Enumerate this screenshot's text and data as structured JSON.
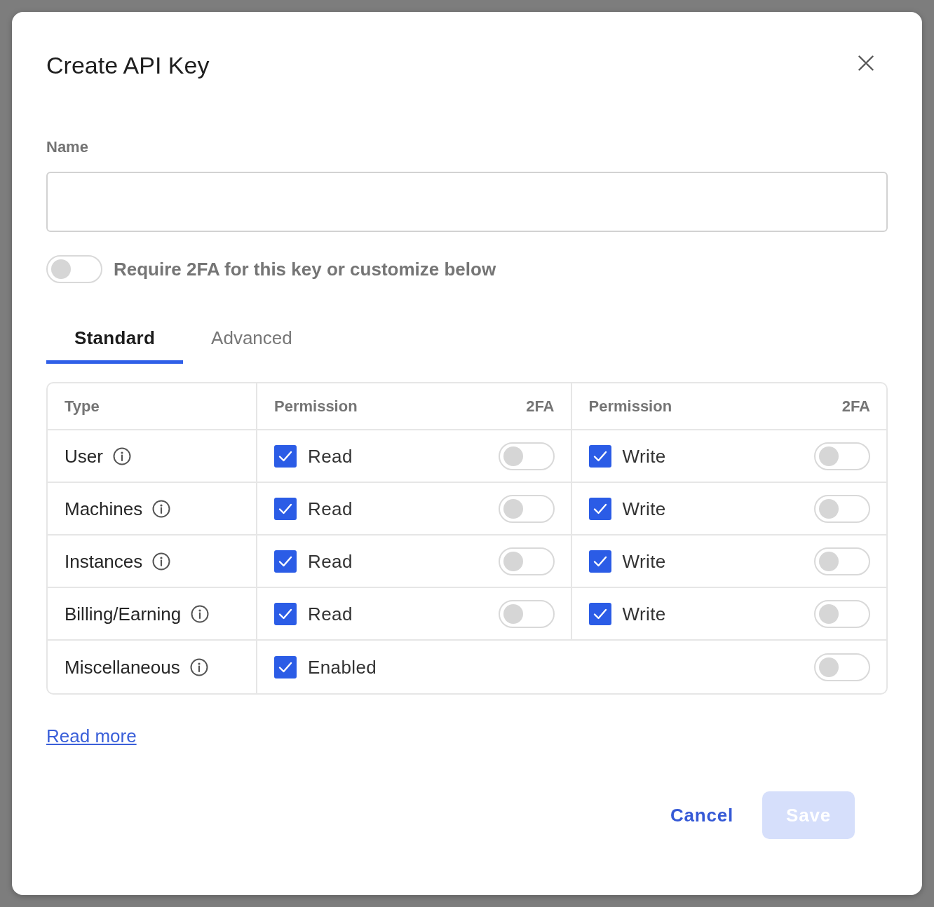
{
  "dialog": {
    "title": "Create API Key"
  },
  "name_field": {
    "label": "Name"
  },
  "require_2fa": {
    "label": "Require 2FA for this key or customize below",
    "on": false
  },
  "tabs": [
    {
      "label": "Standard",
      "selected": true
    },
    {
      "label": "Advanced",
      "selected": false
    }
  ],
  "table": {
    "columns": [
      "Type",
      "Permission",
      "2FA",
      "Permission",
      "2FA"
    ],
    "rows": [
      {
        "type": "User",
        "permissions": [
          {
            "label": "Read",
            "checked": true,
            "two_fa_on": false
          },
          {
            "label": "Write",
            "checked": true,
            "two_fa_on": false
          }
        ]
      },
      {
        "type": "Machines",
        "permissions": [
          {
            "label": "Read",
            "checked": true,
            "two_fa_on": false
          },
          {
            "label": "Write",
            "checked": true,
            "two_fa_on": false
          }
        ]
      },
      {
        "type": "Instances",
        "permissions": [
          {
            "label": "Read",
            "checked": true,
            "two_fa_on": false
          },
          {
            "label": "Write",
            "checked": true,
            "two_fa_on": false
          }
        ]
      },
      {
        "type": "Billing/Earning",
        "permissions": [
          {
            "label": "Read",
            "checked": true,
            "two_fa_on": false
          },
          {
            "label": "Write",
            "checked": true,
            "two_fa_on": false
          }
        ]
      },
      {
        "type": "Miscellaneous",
        "permissions": [
          {
            "label": "Enabled",
            "checked": true,
            "two_fa_on": false
          }
        ]
      }
    ]
  },
  "link": {
    "label": "Read more"
  },
  "buttons": [
    {
      "label": "Cancel",
      "kind": "secondary",
      "disabled": false
    },
    {
      "label": "Save",
      "kind": "primary",
      "disabled": true
    }
  ]
}
